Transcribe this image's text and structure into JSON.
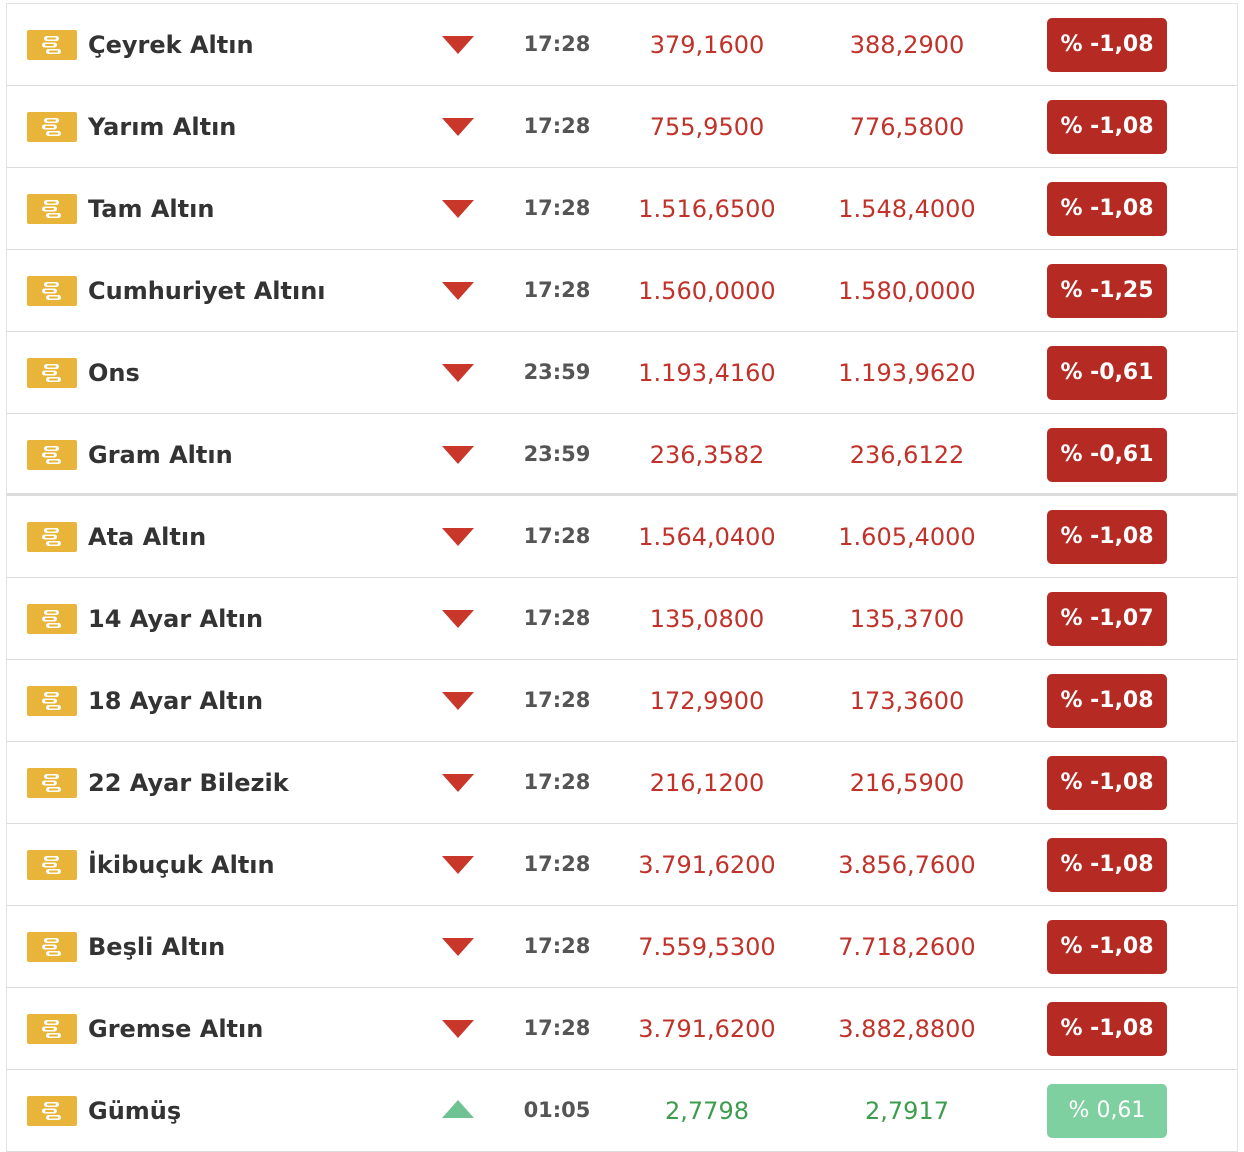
{
  "rows": [
    {
      "name": "Çeyrek Altın",
      "direction": "down",
      "time": "17:28",
      "buy": "379,1600",
      "sell": "388,2900",
      "change": "% -1,08"
    },
    {
      "name": "Yarım Altın",
      "direction": "down",
      "time": "17:28",
      "buy": "755,9500",
      "sell": "776,5800",
      "change": "% -1,08"
    },
    {
      "name": "Tam Altın",
      "direction": "down",
      "time": "17:28",
      "buy": "1.516,6500",
      "sell": "1.548,4000",
      "change": "% -1,08"
    },
    {
      "name": "Cumhuriyet Altını",
      "direction": "down",
      "time": "17:28",
      "buy": "1.560,0000",
      "sell": "1.580,0000",
      "change": "% -1,25"
    },
    {
      "name": "Ons",
      "direction": "down",
      "time": "23:59",
      "buy": "1.193,4160",
      "sell": "1.193,9620",
      "change": "% -0,61"
    },
    {
      "name": "Gram Altın",
      "direction": "down",
      "time": "23:59",
      "buy": "236,3582",
      "sell": "236,6122",
      "change": "% -0,61"
    },
    {
      "name": "Ata Altın",
      "direction": "down",
      "time": "17:28",
      "buy": "1.564,0400",
      "sell": "1.605,4000",
      "change": "% -1,08"
    },
    {
      "name": "14 Ayar Altın",
      "direction": "down",
      "time": "17:28",
      "buy": "135,0800",
      "sell": "135,3700",
      "change": "% -1,07"
    },
    {
      "name": "18 Ayar Altın",
      "direction": "down",
      "time": "17:28",
      "buy": "172,9900",
      "sell": "173,3600",
      "change": "% -1,08"
    },
    {
      "name": "22 Ayar Bilezik",
      "direction": "down",
      "time": "17:28",
      "buy": "216,1200",
      "sell": "216,5900",
      "change": "% -1,08"
    },
    {
      "name": "İkibuçuk Altın",
      "direction": "down",
      "time": "17:28",
      "buy": "3.791,6200",
      "sell": "3.856,7600",
      "change": "% -1,08"
    },
    {
      "name": "Beşli Altın",
      "direction": "down",
      "time": "17:28",
      "buy": "7.559,5300",
      "sell": "7.718,2600",
      "change": "% -1,08"
    },
    {
      "name": "Gremse Altın",
      "direction": "down",
      "time": "17:28",
      "buy": "3.791,6200",
      "sell": "3.882,8800",
      "change": "% -1,08"
    },
    {
      "name": "Gümüş",
      "direction": "up",
      "time": "01:05",
      "buy": "2,7798",
      "sell": "2,7917",
      "change": "% 0,61"
    }
  ],
  "colors": {
    "negative_text": "#c0322a",
    "positive_text": "#3d9c4e",
    "negative_badge": "#b52a22",
    "positive_badge": "#7fd0a0",
    "down_arrow": "#c9362a",
    "up_arrow": "#6fc393",
    "coin_icon": "#e8b53a"
  },
  "icons": {
    "row_icon": "gold-coins-icon"
  }
}
